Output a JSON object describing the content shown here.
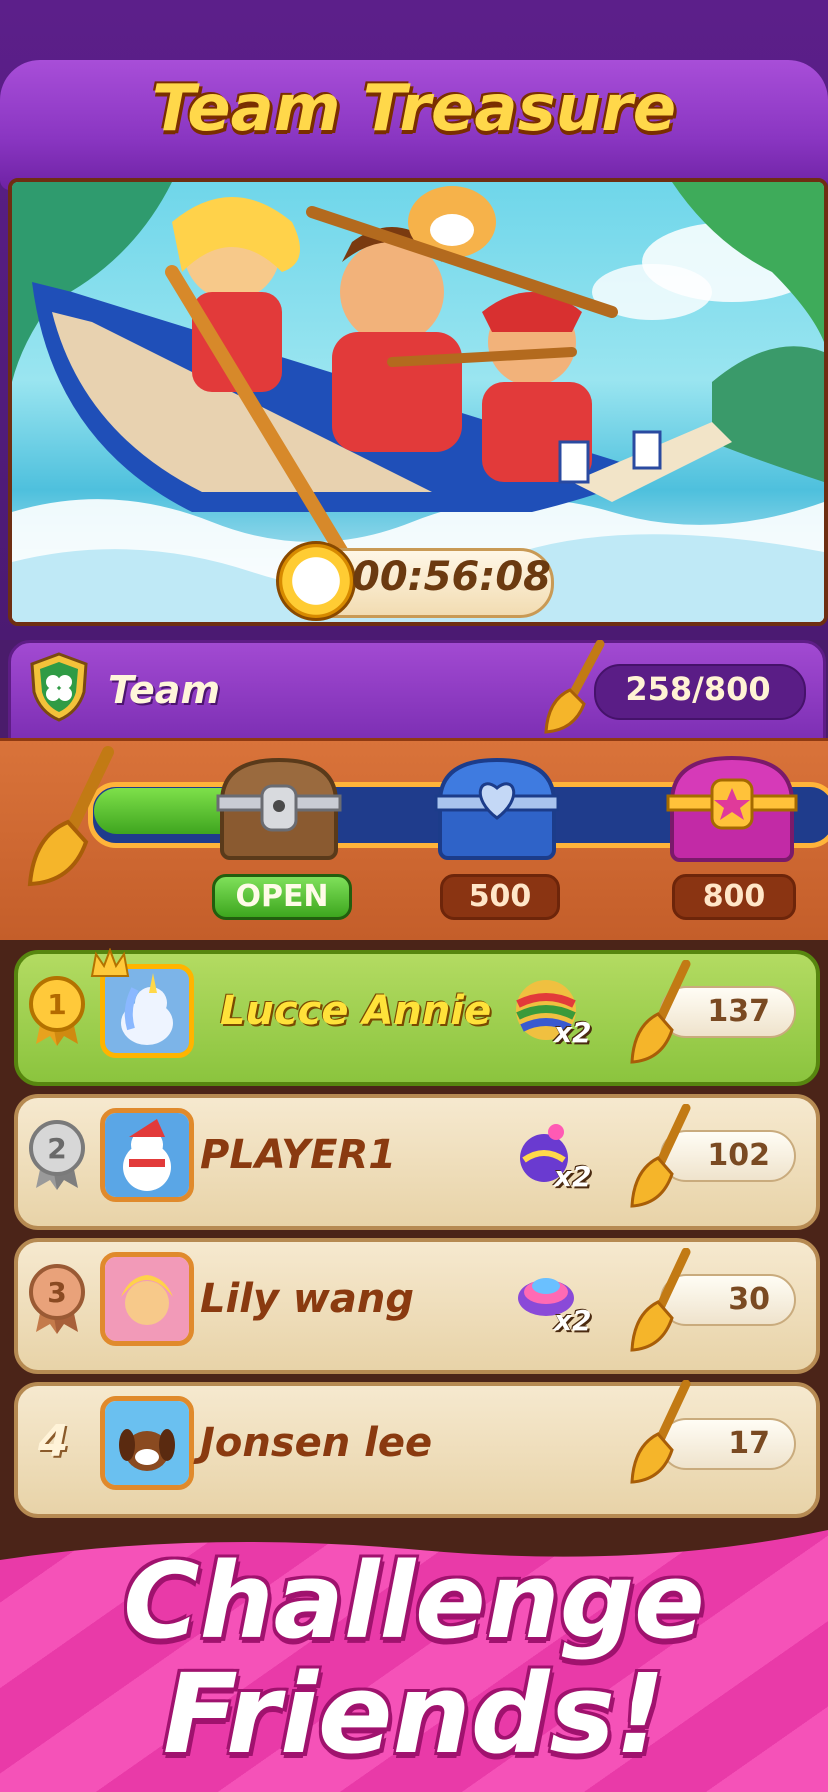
{
  "header": {
    "title": "Team Treasure"
  },
  "event": {
    "timer": "00:56:08"
  },
  "team": {
    "label": "Team",
    "score": "258/800",
    "progress": 0.3225
  },
  "milestones": [
    {
      "label": "OPEN",
      "state": "open"
    },
    {
      "label": "500",
      "state": "locked"
    },
    {
      "label": "800",
      "state": "locked"
    }
  ],
  "leaderboard": [
    {
      "rank": "1",
      "name": "Lucce Annie",
      "boost": "x2",
      "points": "137"
    },
    {
      "rank": "2",
      "name": "PLAYER1",
      "boost": "x2",
      "points": "102"
    },
    {
      "rank": "3",
      "name": "Lily wang",
      "boost": "x2",
      "points": "30"
    },
    {
      "rank": "4",
      "name": "Jonsen lee",
      "boost": "",
      "points": "17"
    }
  ],
  "footer": {
    "line1": "Challenge",
    "line2": "Friends!"
  },
  "colors": {
    "accent_purple": "#8a36c2",
    "title_gold": "#ffd84a",
    "gold_row": "#9ccf4e",
    "cream_row": "#f0dfbc",
    "footer_pink": "#f04ab4"
  }
}
